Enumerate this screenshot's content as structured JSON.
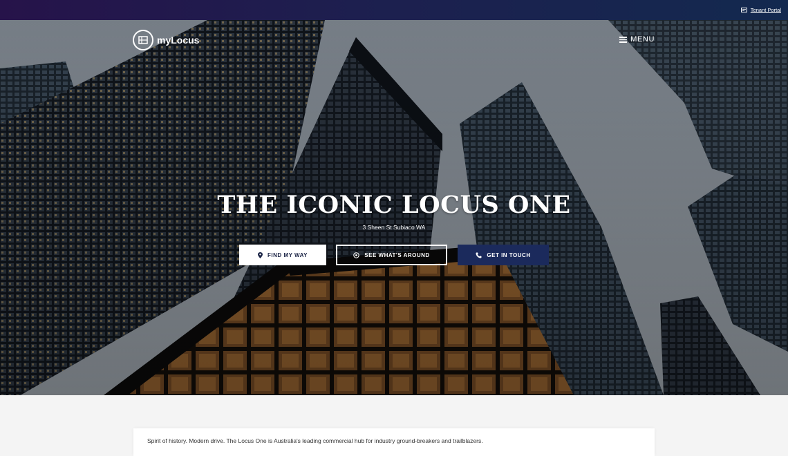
{
  "topbar": {
    "tenant_portal_label": "Tenant Portal",
    "tenant_icon": "card-icon"
  },
  "header": {
    "logo_text": "myLocus",
    "menu_label": "MENU"
  },
  "hero": {
    "title": "THE ICONIC LOCUS ONE",
    "address": "3 Sheen St Subiaco WA",
    "buttons": {
      "find": "FIND MY WAY",
      "around": "SEE WHAT'S AROUND",
      "contact": "GET IN TOUCH"
    }
  },
  "intro": {
    "text": "Spirit of history. Modern drive. The Locus One is Australia's leading commercial hub for industry ground-breakers and trailblazers."
  },
  "colors": {
    "topbar": "#1d1f4f",
    "primary_button": "#1b2a5c",
    "page_background": "#f4f4f4"
  }
}
